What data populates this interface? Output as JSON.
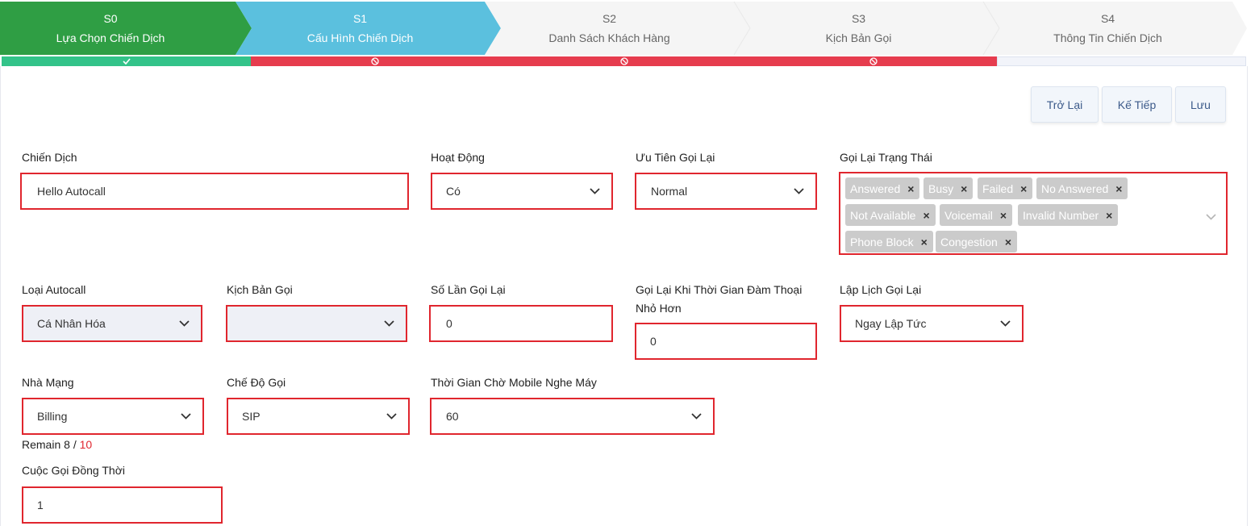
{
  "steps": [
    {
      "code": "S0",
      "title": "Lựa Chọn Chiến Dịch",
      "state": "done"
    },
    {
      "code": "S1",
      "title": "Cấu Hình Chiến Dịch",
      "state": "active"
    },
    {
      "code": "S2",
      "title": "Danh Sách Khách Hàng",
      "state": "pending"
    },
    {
      "code": "S3",
      "title": "Kịch Bản Gọi",
      "state": "pending"
    },
    {
      "code": "S4",
      "title": "Thông Tin Chiến Dịch",
      "state": "pending"
    }
  ],
  "status_icons": {
    "done": "check-icon",
    "blocked": "ban-icon"
  },
  "colors": {
    "done": "#2f9e44",
    "active": "#5bc0de",
    "pending": "#f5f5f5",
    "error": "#e0262e",
    "success_bar": "#33c389",
    "blocked_bar": "#e63c4e"
  },
  "actions": {
    "back": "Trở Lại",
    "next": "Kế Tiếp",
    "save": "Lưu"
  },
  "form": {
    "campaign": {
      "label": "Chiến Dịch",
      "value": "Hello Autocall"
    },
    "active": {
      "label": "Hoạt Động",
      "value": "Có"
    },
    "recall_priority": {
      "label": "Ưu Tiên Gọi Lại",
      "value": "Normal"
    },
    "recall_status": {
      "label": "Gọi Lại Trạng Thái",
      "tags": [
        "Answered",
        "Busy",
        "Failed",
        "No Answered",
        "Not Available",
        "Voicemail",
        "Invalid Number",
        "Phone Block",
        "Congestion"
      ]
    },
    "autocall_type": {
      "label": "Loại Autocall",
      "value": "Cá Nhân Hóa"
    },
    "script": {
      "label": "Kịch Bản Gọi",
      "value": ""
    },
    "recall_count": {
      "label": "Số Lần Gọi Lại",
      "value": "0"
    },
    "recall_short": {
      "label_line1": "Gọi Lại Khi Thời Gian Đàm Thoại",
      "label_line2": "Nhỏ Hơn",
      "value": "0"
    },
    "recall_schedule": {
      "label": "Lập Lịch Gọi Lại",
      "value": "Ngay Lập Tức"
    },
    "carrier": {
      "label": "Nhà Mạng",
      "value": "Billing"
    },
    "call_mode": {
      "label": "Chế Độ Gọi",
      "value": "SIP"
    },
    "mobile_wait": {
      "label": "Thời Gian Chờ Mobile Nghe Máy",
      "value": "60"
    },
    "remain": {
      "prefix": "Remain",
      "current": "8",
      "sep": " / ",
      "max": "10"
    },
    "concurrent": {
      "label": "Cuộc Gọi Đồng Thời",
      "value": "1"
    }
  }
}
